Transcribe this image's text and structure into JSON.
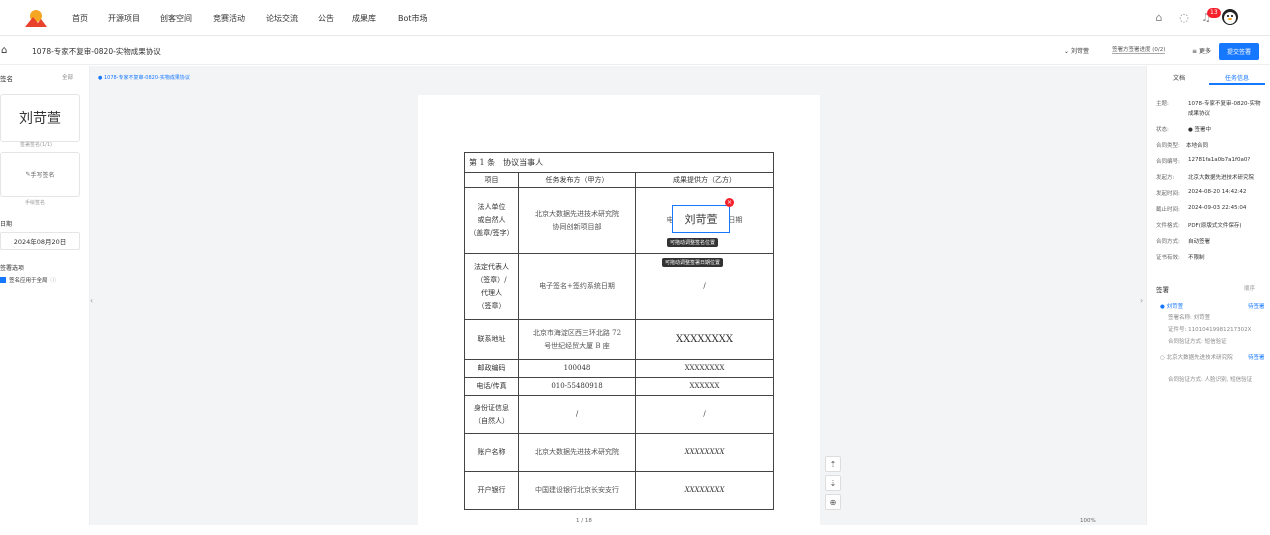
{
  "nav": {
    "items": [
      "首页",
      "开源项目",
      "创客空间",
      "竞赛活动",
      "论坛交流",
      "公告",
      "成果库",
      "Bot市场"
    ],
    "badge": "13"
  },
  "subbar": {
    "title": "1078-专家不复审-0820-实物成果协议",
    "signer_label": "刘苛萱",
    "progress": "签署方签署进度 (0/2)",
    "more": "更多",
    "submit": "提交签署"
  },
  "left": {
    "sign_title": "签名",
    "all": "全部",
    "signature": "刘苛萱",
    "sign_count": "签署签名(1/1)",
    "handwrite": "手写签名",
    "handwrite_hint": "手绘签名",
    "date_label": "日期",
    "date_value": "2024年08月20日",
    "seal_label": "签署选项",
    "seal_check": "签名应用于全局"
  },
  "breadcrumb": "1078-专家不复审-0820-实物成果协议",
  "contract": {
    "heading": "第 1 条　协议当事人",
    "headers": [
      "项目",
      "任务发布方（甲方）",
      "成果提供方（乙方）"
    ],
    "rows": [
      {
        "label": [
          "法人单位",
          "或自然人",
          "（盖章/签字）"
        ],
        "a": [
          "北京大数据先进技术研究院",
          "协同创新项目部"
        ],
        "b": "电子签名+签约系统日期"
      },
      {
        "label": [
          "法定代表人",
          "（签章）/",
          "代理人",
          "（签章）"
        ],
        "a": [
          "电子签名+签约系统日期"
        ],
        "b": "/"
      },
      {
        "label": [
          "联系地址"
        ],
        "a": [
          "北京市海淀区西三环北路 72",
          "号世纪经贸大厦 B 座"
        ],
        "b": "XXXXXXXX"
      },
      {
        "label": [
          "邮政编码"
        ],
        "a": [
          "100048"
        ],
        "b": "XXXXXXXX"
      },
      {
        "label": [
          "电话/传真"
        ],
        "a": [
          "010-55480918"
        ],
        "b": "XXXXXX"
      },
      {
        "label": [
          "身份证信息",
          "（自然人）"
        ],
        "a": [
          "/"
        ],
        "b": "/"
      },
      {
        "label": [
          "账户名称"
        ],
        "a": [
          "北京大数据先进技术研究院"
        ],
        "b": "XXXXXXXX"
      },
      {
        "label": [
          "开户银行"
        ],
        "a": [
          "中国建设银行北京长安支行"
        ],
        "b": "XXXXXXXX"
      }
    ]
  },
  "signbox": {
    "name": "刘苛萱",
    "tip1": "可拖动调整签名位置",
    "tip2": "可拖动调整签署日期位置"
  },
  "right": {
    "tabs": [
      "文档",
      "任务信息"
    ],
    "info": [
      {
        "k": "主题:",
        "v": "1078-专家不复审-0820-实物"
      },
      {
        "k": "",
        "v": "成果协议"
      },
      {
        "k": "状态:",
        "v": "● 签署中"
      },
      {
        "k": "合同类型:",
        "v": "本地合同"
      },
      {
        "k": "合同编号:",
        "v": "12781fa1a0b7a1f0a0?"
      },
      {
        "k": "发起方:",
        "v": "北京大数据先进技术研究院"
      },
      {
        "k": "发起时间:",
        "v": "2024-08-20 14:42:42"
      },
      {
        "k": "截止时间:",
        "v": "2024-09-03 22:45:04"
      },
      {
        "k": "文件格式:",
        "v": "PDF(原版式文件保存)"
      },
      {
        "k": "合同方式:",
        "v": "自动签署"
      },
      {
        "k": "证书有效:",
        "v": "不限制"
      }
    ],
    "signers_title": "签署",
    "order": "顺序",
    "signer1": {
      "name": "刘苛萱",
      "status": "待签署",
      "l1": "签署名称: 刘苛萱",
      "l2": "证件号: 11010419981217302X",
      "l3": "合同验证方式: 短信验证"
    },
    "signer2": {
      "name": "北京大数据先进技术研究院",
      "status": "待签署",
      "l3": "合同验证方式: 人脸识别, 短信验证"
    }
  },
  "bottom": {
    "page": "1 / 18",
    "zoom": "100%"
  }
}
